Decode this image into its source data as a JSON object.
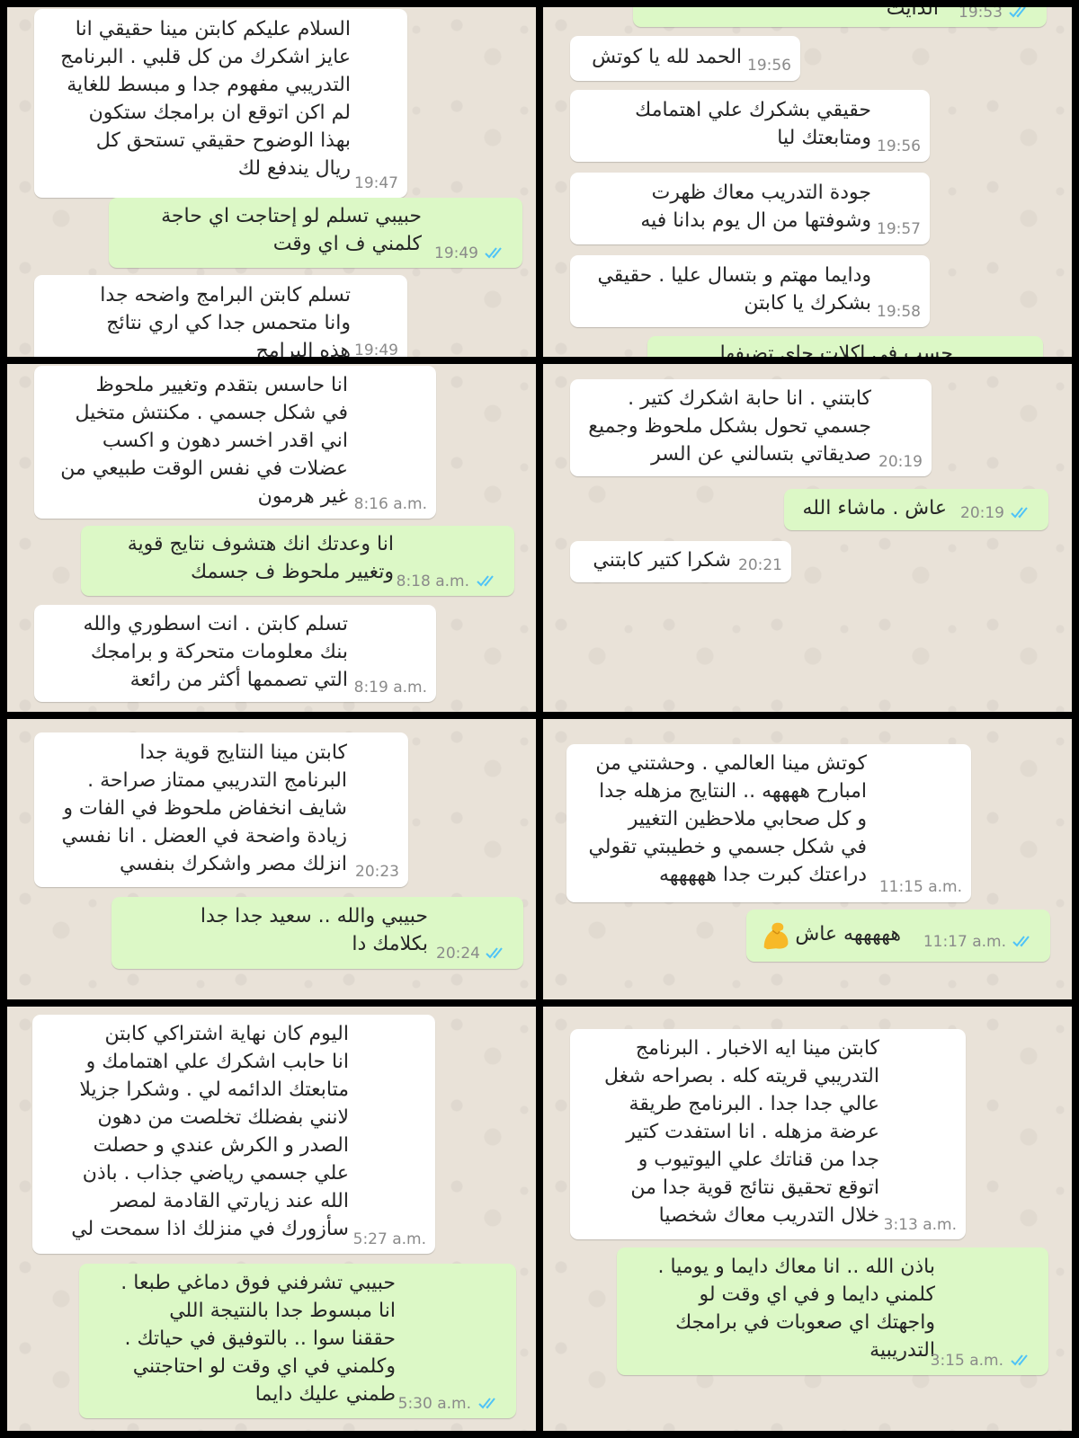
{
  "panels": [
    {
      "messages": [
        {
          "text": "السلام عليكم كابتن مينا حقيقي انا\nعايز اشكرك من كل قلبي . البرنامج\nالتدريبي مفهوم جدا و مبسط للغاية\nلم اكن اتوقع ان برامجك ستكون\nبهذا الوضوح حقيقي تستحق كل\nريال يندفع لك",
          "time": "19:47"
        },
        {
          "text": "حبيبي تسلم لو إحتاجت اي حاجة\nكلمني ف اي وقت",
          "time": "19:49"
        },
        {
          "text": "تسلم كابتن البرامج واضحه جدا\nوانا متحمس جدا كي اري نتائج\nهذه البرامج",
          "time": "19:49"
        }
      ]
    },
    {
      "messages": [
        {
          "text": "الدايت",
          "time": "19:53"
        },
        {
          "text": "الحمد لله يا كوتش",
          "time": "19:56"
        },
        {
          "text": "حقيقي بشكرك علي اهتمامك\nومتابعتك ليا",
          "time": "19:56"
        },
        {
          "text": "جودة التدريب معاك ظهرت\nوشوفتها من ال يوم بدانا فيه",
          "time": "19:57"
        },
        {
          "text": "ودايما مهتم و بتسال عليا . حقيقي\nبشكرك يا كابتن",
          "time": "19:58"
        },
        {
          "text": "حسب في اكلات جاي تضيفها",
          "time": ""
        }
      ]
    },
    {
      "messages": [
        {
          "text": "انا حاسس بتقدم وتغيير ملحوظ\nفي شكل جسمي . مكنتش متخيل\nاني اقدر اخسر دهون و اكسب\nعضلات في نفس الوقت طبيعي من\nغير هرمون",
          "time": "8:16 a.m."
        },
        {
          "text": "انا وعدتك انك هتشوف نتايج قوية\nوتغيير ملحوظ ف جسمك",
          "time": "8:18 a.m."
        },
        {
          "text": "تسلم كابتن . انت اسطوري والله\nبنك معلومات متحركة و برامجك\nالتي تصممها أكثر من رائعة",
          "time": "8:19 a.m."
        }
      ]
    },
    {
      "messages": [
        {
          "text": "كابتني . انا حابة اشكرك كتير .\nجسمي تحول بشكل ملحوظ وجميع\nصديقاتي بتسالني عن السر",
          "time": "20:19"
        },
        {
          "text": "عاش . ماشاء الله",
          "time": "20:19"
        },
        {
          "text": "شكرا كتير كابتني",
          "time": "20:21"
        }
      ]
    },
    {
      "messages": [
        {
          "text": "كابتن مينا النتايج قوية جدا\nالبرنامج التدريبي ممتاز صراحة .\nشايف انخفاض ملحوظ في الفات و\nزيادة واضحة في العضل . انا نفسي\nانزلك مصر واشكرك بنفسي",
          "time": "20:23"
        },
        {
          "text": "حبيبي والله .. سعيد جدا جدا\nبكلامك دا",
          "time": "20:24"
        }
      ]
    },
    {
      "messages": [
        {
          "text": "كوتش مينا العالمي . وحشتني من\nامبارح ههههه .. النتايج مزهله جدا\nو كل صحابي ملاحظين التغيير\nفي شكل جسمي و خطيبتي تقولي\nدراعتك كبرت جدا هههههه",
          "time": "11:15 a.m."
        },
        {
          "text": "هههههه عاش",
          "time": "11:17 a.m."
        }
      ]
    },
    {
      "messages": [
        {
          "text": "اليوم كان نهاية اشتراكي كابتن\nانا حابب اشكرك علي اهتمامك و\nمتابعتك الدائمه لي . وشكرا جزيلا\nلانني بفضلك تخلصت من دهون\nالصدر و الكرش عندي و حصلت\nعلي جسمي رياضي جذاب . باذن\nالله عند زيارتي القادمة لمصر\nسأزورك في منزلك اذا سمحت لي",
          "time": "5:27 a.m."
        },
        {
          "text": "حبيبي تشرفني فوق دماغي طبعا .\nانا مبسوط جدا بالنتيجة اللي\nحققنا سوا .. بالتوفيق في حياتك .\nوكلمني في اي وقت لو احتاجتني\nطمني عليك دايما",
          "time": "5:30 a.m."
        }
      ]
    },
    {
      "messages": [
        {
          "text": "كابتن مينا ايه الاخبار . البرنامج\nالتدريبي قريته كله . بصراحه شغل\nعالي جدا جدا . البرنامج طريقة\nعرضة مزهله . انا استفدت كتير\nجدا من قناتك علي اليوتيوب و\nاتوقع تحقيق نتائج قوية جدا من\nخلال التدريب معاك شخصيا",
          "time": "3:13 a.m."
        },
        {
          "text": "باذن الله .. انا معاك دايما و يوميا .\nكلمني دايما و في اي وقت لو\nواجهتك اي صعوبات في برامجك\nالتدريبية",
          "time": "3:15 a.m."
        }
      ]
    }
  ],
  "icons": {
    "read_receipt": "double-check-icon",
    "emoji": "flexed-biceps-emoji"
  },
  "colors": {
    "incoming": "#ffffff",
    "outgoing": "#dcf8c6",
    "tick": "#4fc3f7",
    "wallpaper": "#e9e2d8"
  }
}
